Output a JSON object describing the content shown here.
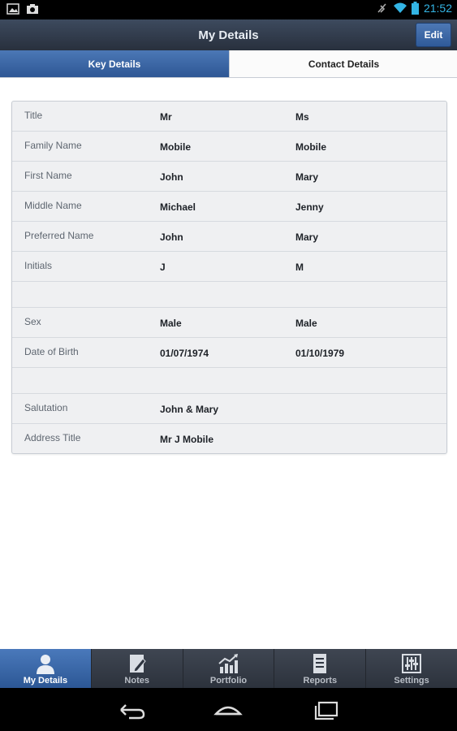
{
  "status_bar": {
    "time": "21:52",
    "icons": [
      "gallery-icon",
      "camera-icon",
      "notification-mute-icon",
      "wifi-icon",
      "battery-icon"
    ],
    "accent_color": "#33b5e5"
  },
  "header": {
    "title": "My Details",
    "edit_label": "Edit"
  },
  "tabs": [
    {
      "label": "Key Details",
      "active": true
    },
    {
      "label": "Contact Details",
      "active": false
    }
  ],
  "details": {
    "rows": [
      {
        "label": "Title",
        "value1": "Mr",
        "value2": "Ms"
      },
      {
        "label": "Family Name",
        "value1": "Mobile",
        "value2": "Mobile"
      },
      {
        "label": "First Name",
        "value1": "John",
        "value2": "Mary"
      },
      {
        "label": "Middle Name",
        "value1": "Michael",
        "value2": "Jenny"
      },
      {
        "label": "Preferred Name",
        "value1": "John",
        "value2": "Mary"
      },
      {
        "label": "Initials",
        "value1": "J",
        "value2": "M"
      },
      {
        "blank": true
      },
      {
        "label": "Sex",
        "value1": "Male",
        "value2": "Male"
      },
      {
        "label": "Date of Birth",
        "value1": "01/07/1974",
        "value2": "01/10/1979"
      },
      {
        "blank": true
      },
      {
        "label": "Salutation",
        "value1": "John & Mary",
        "value2": ""
      },
      {
        "label": "Address Title",
        "value1": "Mr J Mobile",
        "value2": ""
      }
    ]
  },
  "bottom_nav": [
    {
      "label": "My Details",
      "icon": "person-icon",
      "active": true
    },
    {
      "label": "Notes",
      "icon": "notes-icon",
      "active": false
    },
    {
      "label": "Portfolio",
      "icon": "chart-icon",
      "active": false
    },
    {
      "label": "Reports",
      "icon": "report-icon",
      "active": false
    },
    {
      "label": "Settings",
      "icon": "settings-icon",
      "active": false
    }
  ],
  "system_nav": [
    "back-icon",
    "home-icon",
    "recent-apps-icon"
  ],
  "colors": {
    "accent_blue": "#3a67a8",
    "header_dark": "#2f3745"
  }
}
